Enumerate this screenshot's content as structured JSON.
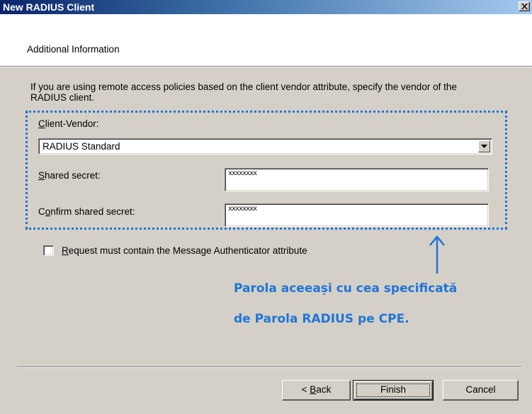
{
  "window": {
    "title": "New RADIUS Client"
  },
  "header": {
    "section_title": "Additional Information"
  },
  "intro": {
    "text": "If you are using remote access policies based on the client vendor attribute, specify the vendor of the RADIUS client."
  },
  "form": {
    "client_vendor": {
      "label_prefix": "",
      "label_mnemonic": "C",
      "label_rest": "lient-Vendor:",
      "value": "RADIUS Standard"
    },
    "shared_secret": {
      "label_prefix": "",
      "label_mnemonic": "S",
      "label_rest": "hared secret:",
      "value": "xxxxxxxx"
    },
    "confirm_secret": {
      "label_prefix": "C",
      "label_mnemonic": "o",
      "label_rest": "nfirm shared secret:",
      "value": "xxxxxxxx"
    },
    "message_authenticator": {
      "label_prefix": "",
      "label_mnemonic": "R",
      "label_rest": "equest must contain the Message Authenticator attribute",
      "checked": false
    }
  },
  "annotation": {
    "line1": "Parola aceeași cu cea specificată",
    "line2": "de Parola RADIUS pe CPE.",
    "color": "#1f74d6"
  },
  "buttons": {
    "back": {
      "prefix": "< ",
      "mnemonic": "B",
      "rest": "ack"
    },
    "finish": {
      "label": "Finish"
    },
    "cancel": {
      "label": "Cancel"
    }
  },
  "icons": {
    "close": "close-icon",
    "dropdown": "dropdown-arrow-icon",
    "annotation_arrow": "arrow-up-icon"
  }
}
